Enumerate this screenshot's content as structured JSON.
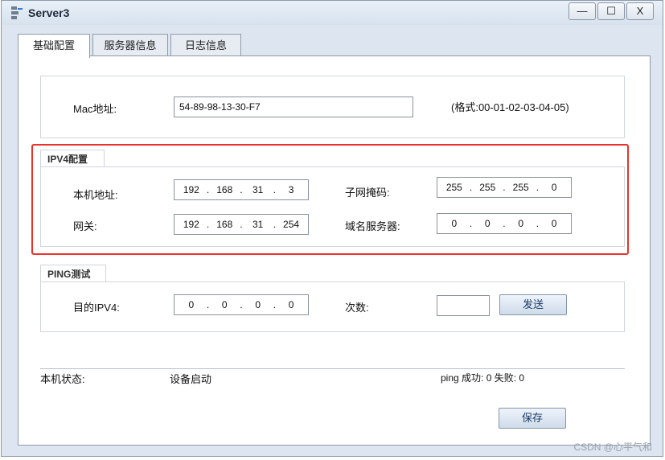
{
  "window": {
    "title": "Server3",
    "controls": {
      "minimize": "—",
      "maximize": "☐",
      "close": "X"
    }
  },
  "tabs": [
    {
      "label": "基础配置",
      "active": true
    },
    {
      "label": "服务器信息",
      "active": false
    },
    {
      "label": "日志信息",
      "active": false
    }
  ],
  "mac": {
    "label": "Mac地址:",
    "value": "54-89-98-13-30-F7",
    "format_hint": "(格式:00-01-02-03-04-05)"
  },
  "ipv4": {
    "section_title": "IPV4配置",
    "host_ip_label": "本机地址:",
    "host_ip": [
      "192",
      "168",
      "31",
      "3"
    ],
    "subnet_label": "子网掩码:",
    "subnet": [
      "255",
      "255",
      "255",
      "0"
    ],
    "gateway_label": "网关:",
    "gateway": [
      "192",
      "168",
      "31",
      "254"
    ],
    "dns_label": "域名服务器:",
    "dns": [
      "0",
      "0",
      "0",
      "0"
    ]
  },
  "ping": {
    "section_title": "PING测试",
    "dest_label": "目的IPV4:",
    "dest_ip": [
      "0",
      "0",
      "0",
      "0"
    ],
    "count_label": "次数:",
    "count_value": "",
    "send_button": "发送"
  },
  "status": {
    "host_state_label": "本机状态:",
    "host_state_value": "设备启动",
    "ping_result": "ping 成功: 0 失败: 0"
  },
  "save_button": "保存",
  "watermark": "CSDN @心平气和",
  "highlight_color": "#e8332b"
}
